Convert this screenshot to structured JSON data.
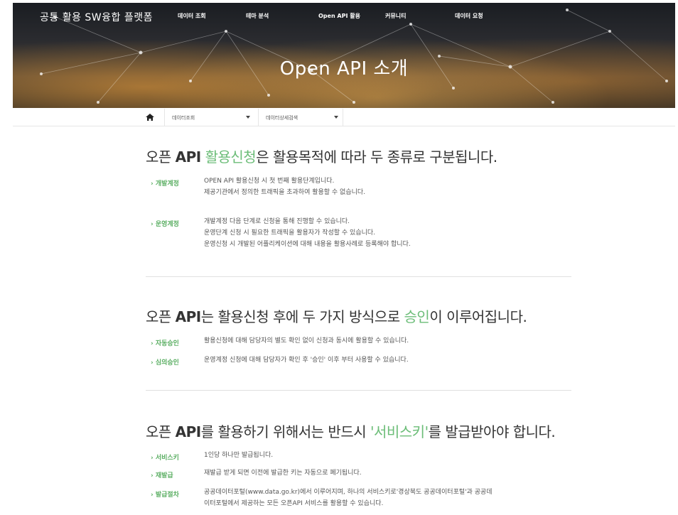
{
  "header": {
    "site_title": "공통 활용 SW융합 플랫폼",
    "nav": [
      "데이터 조회",
      "테마 분석",
      "Open API 활용",
      "커뮤니티",
      "데이터 요청"
    ],
    "hero_title": "Open API 소개"
  },
  "breadcrumb": {
    "level1": "데이터조회",
    "level2": "데이터상세검색"
  },
  "sections": [
    {
      "title_pre": "오픈 ",
      "title_bold": "API",
      "title_mid": " ",
      "title_hl": "활용신청",
      "title_post": "은 활용목적에 따라 두 종류로 구분됩니다.",
      "rows": [
        {
          "label": "› 개발계정",
          "lines": [
            "OPEN API 활용신청 시 첫 번째 활용단계입니다.",
            "제공기관에서 정의한 트래픽을 초과하여 활용할 수 없습니다."
          ]
        },
        {
          "label": "› 운영계정",
          "lines": [
            "개발계정 다음 단계로 신청을 통해 진행할 수 있습니다.",
            "운영단계 신청 시 필요한 트래픽을 활용자가 작성할 수 있습니다.",
            "운영신청 시 개발된 어플리케이션에 대해 내용을 활용사례로 등록해야 합니다."
          ]
        }
      ]
    },
    {
      "title_pre": "오픈 ",
      "title_bold": "API",
      "title_mid": "는 활용신청 후에 두 가지 방식으로 ",
      "title_hl": "승인",
      "title_post": "이 이루어집니다.",
      "rows": [
        {
          "label": "› 자동승인",
          "lines": [
            "활용신청에 대해 담당자의 별도 확인 없이 신청과 동시에 활용할 수 있습니다."
          ]
        },
        {
          "label": "› 심의승인",
          "lines": [
            "운영계정 신청에 대해 담당자가 확인 후 '승인' 이후 부터 사용할 수 있습니다."
          ]
        }
      ]
    },
    {
      "title_pre": "오픈 ",
      "title_bold": "API",
      "title_mid": "를 활용하기 위해서는 반드시 ",
      "title_hl": "'서비스키'",
      "title_post": "를 발급받아야 합니다.",
      "rows": [
        {
          "label": "› 서비스키",
          "lines": [
            "1인당 하나만 발급됩니다."
          ]
        },
        {
          "label": "› 재발급",
          "lines": [
            "재발급 받게 되면 이전에 발급한 키는 자동으로 폐기됩니다."
          ]
        },
        {
          "label": "› 발급절차",
          "lines": [
            "공공데이터포털(www.data.go.kr)에서 이루어지며, 하나의 서비스키로'경상북도 공공데이터포털'과 공공데",
            "이터포털에서 제공하는 모든 오픈API 서비스를 활용할 수 있습니다."
          ]
        }
      ]
    }
  ],
  "icons": {
    "home": "home-icon",
    "dropdown": "caret-down-icon"
  }
}
